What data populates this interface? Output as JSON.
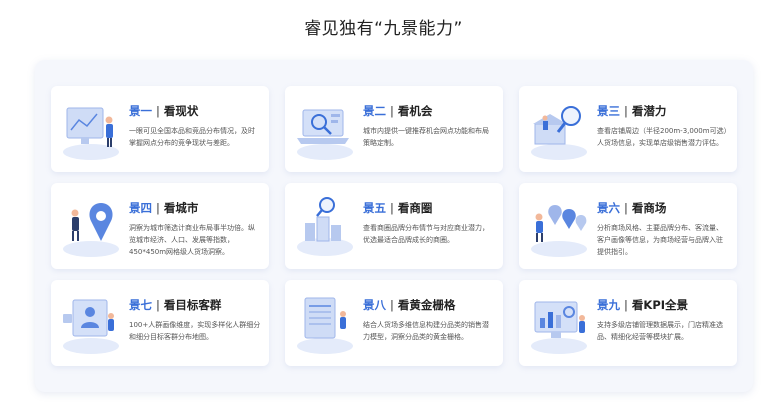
{
  "heading": "睿见独有“九景能力”",
  "cards": [
    {
      "num": "景一",
      "sep": "|",
      "name": "看现状",
      "desc": "一眼可见全国本品和竞品分布情况，及时掌握网点分布的竞争现状与差距。",
      "icon": "monitor-map-icon"
    },
    {
      "num": "景二",
      "sep": "|",
      "name": "看机会",
      "desc": "城市内提供一键推荐机会网点功能和布局策略定制。",
      "icon": "laptop-search-icon"
    },
    {
      "num": "景三",
      "sep": "|",
      "name": "看潜力",
      "desc": "查看店铺周边（半径200m-3,000m可选）人货场信息，实现单店级销售潜力评估。",
      "icon": "magnifier-store-icon"
    },
    {
      "num": "景四",
      "sep": "|",
      "name": "看城市",
      "desc": "洞察为城市筛选计商业布局事半功倍。纵览城市经济、人口、发展等指数，450*450m网格级人货场洞察。",
      "icon": "location-pin-icon"
    },
    {
      "num": "景五",
      "sep": "|",
      "name": "看商圈",
      "desc": "查看商圈品牌分布情节与对应商业潜力，优选最适合品牌成长的商圈。",
      "icon": "city-buildings-icon"
    },
    {
      "num": "景六",
      "sep": "|",
      "name": "看商场",
      "desc": "分析商场风格、主要品牌分布、客流量、客户画像等信息，为商场经营与品牌入驻提供指引。",
      "icon": "mall-pins-icon"
    },
    {
      "num": "景七",
      "sep": "|",
      "name": "看目标客群",
      "desc": "100+人群画像维度，实现多样化人群细分和细分目标客群分布地图。",
      "icon": "audience-profile-icon"
    },
    {
      "num": "景八",
      "sep": "|",
      "name": "看黄金栅格",
      "desc": "结合人货场多维信息构建分品类的销售潜力模型，洞察分品类的黄金栅格。",
      "icon": "grid-board-icon"
    },
    {
      "num": "景九",
      "sep": "|",
      "name": "看KPI全景",
      "desc": "支持多级店铺管理数据展示，门店精准选品、精细化经营等模块扩展。",
      "icon": "kpi-dashboard-icon"
    }
  ],
  "colors": {
    "accent": "#3a6fd8",
    "card_bg": "#ffffff",
    "panel_bg": "#f5f7fc"
  }
}
